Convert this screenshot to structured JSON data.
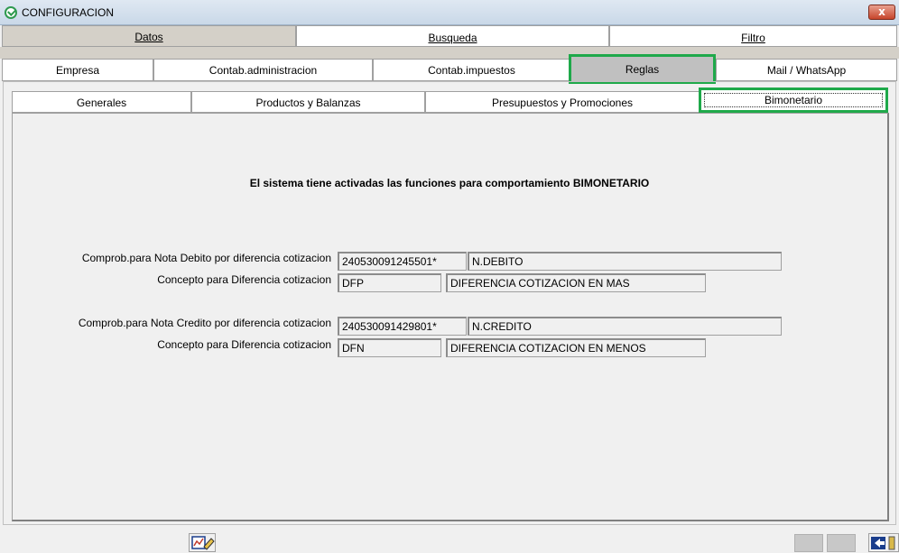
{
  "window": {
    "title": "CONFIGURACION",
    "close_label": "x"
  },
  "tabs_main": [
    {
      "label": "Datos",
      "active": true
    },
    {
      "label": "Busqueda",
      "active": false
    },
    {
      "label": "Filtro",
      "active": false
    }
  ],
  "tabs_datos": [
    {
      "label": "Empresa"
    },
    {
      "label": "Contab.administracion"
    },
    {
      "label": "Contab.impuestos"
    },
    {
      "label": "Reglas",
      "active": true
    },
    {
      "label": "Mail / WhatsApp"
    }
  ],
  "tabs_reglas": [
    {
      "label": "Generales"
    },
    {
      "label": "Productos y Balanzas"
    },
    {
      "label": "Presupuestos y Promociones"
    },
    {
      "label": "Bimonetario",
      "active": true
    }
  ],
  "bimonetario": {
    "heading": "El sistema tiene activadas las funciones para comportamiento BIMONETARIO",
    "debito": {
      "comprob_label": "Comprob.para Nota Debito por diferencia cotizacion",
      "comprob_code": "240530091245501*",
      "comprob_name": "N.DEBITO",
      "concepto_label": "Concepto para Diferencia cotizacion",
      "concepto_code": "DFP",
      "concepto_name": "DIFERENCIA COTIZACION EN MAS"
    },
    "credito": {
      "comprob_label": "Comprob.para Nota Credito por diferencia cotizacion",
      "comprob_code": "240530091429801*",
      "comprob_name": "N.CREDITO",
      "concepto_label": "Concepto para Diferencia cotizacion",
      "concepto_code": "DFN",
      "concepto_name": "DIFERENCIA COTIZACION EN MENOS"
    }
  },
  "colors": {
    "highlight": "#1fa94a",
    "active_tab": "#d4d0c8"
  },
  "icons": {
    "app": "app-logo-icon",
    "report": "report-edit-icon",
    "exit": "exit-door-icon"
  }
}
